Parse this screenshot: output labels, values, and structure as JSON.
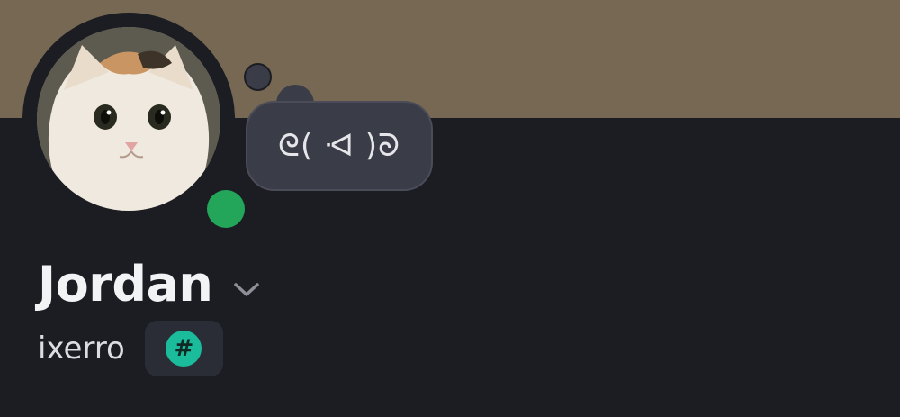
{
  "profile": {
    "display_name": "Jordan",
    "username": "ixerro",
    "custom_status": "ᘓ( ᐗ )ᘐ",
    "online": true
  },
  "badge": {
    "symbol": "#",
    "icon": "hashtag-badge-icon"
  },
  "colors": {
    "banner": "#776854",
    "background": "#1c1d23",
    "status_online": "#23a55a",
    "badge_accent": "#1abc9c"
  },
  "icons": {
    "avatar": "cat-avatar",
    "chevron": "chevron-down-icon",
    "status": "online-status-icon"
  }
}
